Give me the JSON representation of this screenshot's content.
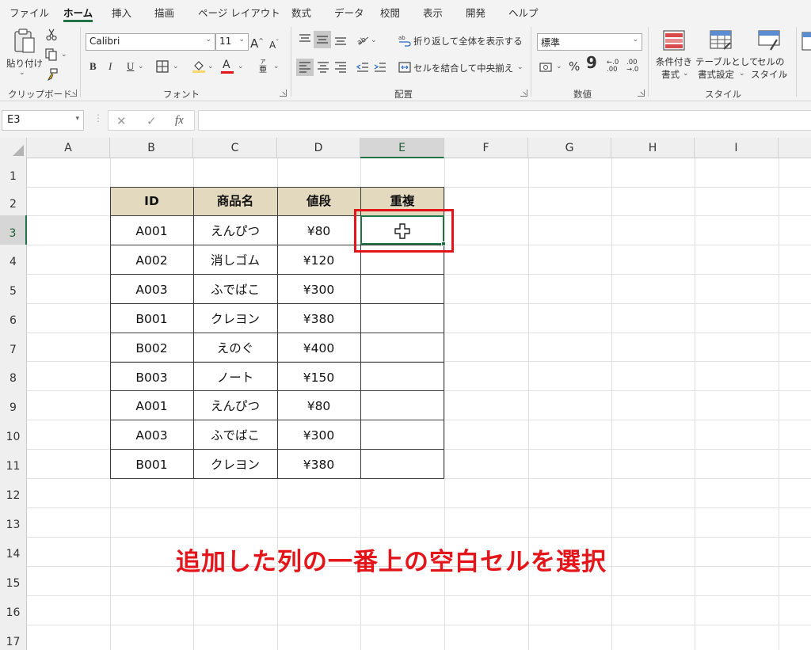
{
  "tabs": [
    "ファイル",
    "ホーム",
    "挿入",
    "描画",
    "ページ レイアウト",
    "数式",
    "データ",
    "校閲",
    "表示",
    "開発",
    "ヘルプ"
  ],
  "active_tab": "ホーム",
  "clipboard": {
    "paste_label": "貼り付け",
    "paste_dd": "⌄",
    "group_label": "クリップボード"
  },
  "font": {
    "name": "Calibri",
    "size": "11",
    "grow": "A",
    "shrink": "A",
    "bold": "B",
    "italic": "I",
    "underline": "U",
    "phonetic_top": "ア",
    "phonetic_bottom": "亜",
    "font_color_letter": "A",
    "group_label": "フォント"
  },
  "alignment": {
    "wrap_text": "折り返して全体を表示する",
    "merge_center": "セルを結合して中央揃え",
    "group_label": "配置"
  },
  "number": {
    "format": "標準",
    "percent": "%",
    "comma": "9",
    "inc_decimal": "←.0 .00",
    "dec_decimal": ".00 →.0",
    "group_label": "数値"
  },
  "styles": {
    "conditional_line1": "条件付き",
    "conditional_line2": "書式",
    "table_line1": "テーブルとして",
    "table_line2": "書式設定",
    "cell_line1": "セルの",
    "cell_line2": "スタイル",
    "group_label": "スタイル"
  },
  "formula_bar": {
    "name_box": "E3",
    "cancel": "✕",
    "enter": "✓",
    "fx": "fx",
    "formula": ""
  },
  "columns": [
    "A",
    "B",
    "C",
    "D",
    "E",
    "F",
    "G",
    "H",
    "I"
  ],
  "rows": [
    "1",
    "2",
    "3",
    "4",
    "5",
    "6",
    "7",
    "8",
    "9",
    "10",
    "11",
    "12",
    "13",
    "14",
    "15",
    "16",
    "17"
  ],
  "selected_cell": "E3",
  "table": {
    "headers": [
      "ID",
      "商品名",
      "値段",
      "重複"
    ],
    "rows": [
      [
        "A001",
        "えんぴつ",
        "¥80",
        ""
      ],
      [
        "A002",
        "消しゴム",
        "¥120",
        ""
      ],
      [
        "A003",
        "ふでばこ",
        "¥300",
        ""
      ],
      [
        "B001",
        "クレヨン",
        "¥380",
        ""
      ],
      [
        "B002",
        "えのぐ",
        "¥400",
        ""
      ],
      [
        "B003",
        "ノート",
        "¥150",
        ""
      ],
      [
        "A001",
        "えんぴつ",
        "¥80",
        ""
      ],
      [
        "A003",
        "ふでばこ",
        "¥300",
        ""
      ],
      [
        "B001",
        "クレヨン",
        "¥380",
        ""
      ]
    ]
  },
  "annotation": "追加した列の一番上の空白セルを選択",
  "colors": {
    "accent": "#217346",
    "header_fill": "#e2d9bf",
    "annotation_red": "#e3141a"
  }
}
